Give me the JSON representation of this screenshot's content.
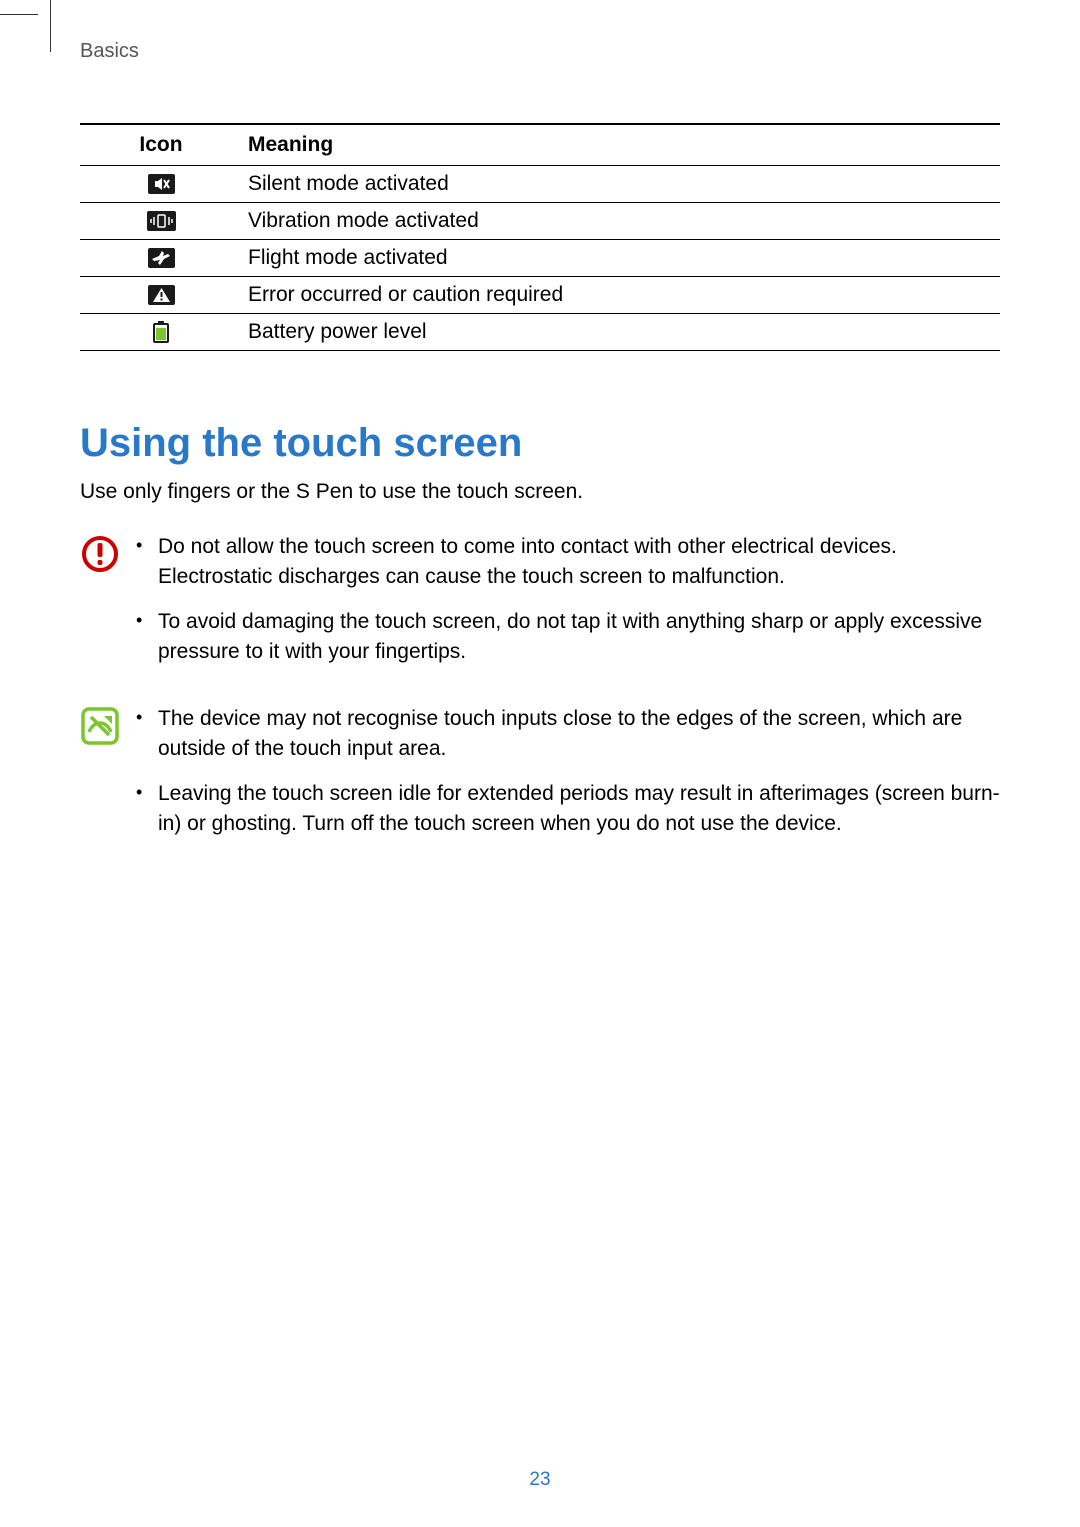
{
  "section_label": "Basics",
  "table": {
    "headers": {
      "icon": "Icon",
      "meaning": "Meaning"
    },
    "rows": [
      {
        "icon_name": "silent-mode-icon",
        "meaning": "Silent mode activated"
      },
      {
        "icon_name": "vibration-mode-icon",
        "meaning": "Vibration mode activated"
      },
      {
        "icon_name": "flight-mode-icon",
        "meaning": "Flight mode activated"
      },
      {
        "icon_name": "caution-icon",
        "meaning": "Error occurred or caution required"
      },
      {
        "icon_name": "battery-level-icon",
        "meaning": "Battery power level"
      }
    ]
  },
  "heading": "Using the touch screen",
  "intro": "Use only fingers or the S Pen to use the touch screen.",
  "callouts": [
    {
      "icon_name": "warning-circle-icon",
      "items": [
        "Do not allow the touch screen to come into contact with other electrical devices. Electrostatic discharges can cause the touch screen to malfunction.",
        "To avoid damaging the touch screen, do not tap it with anything sharp or apply excessive pressure to it with your fingertips."
      ]
    },
    {
      "icon_name": "note-square-icon",
      "items": [
        "The device may not recognise touch inputs close to the edges of the screen, which are outside of the touch input area.",
        "Leaving the touch screen idle for extended periods may result in afterimages (screen burn-in) or ghosting. Turn off the touch screen when you do not use the device."
      ]
    }
  ],
  "page_number": "23",
  "colors": {
    "heading": "#2a78c8",
    "warning": "#cc0000",
    "note_green": "#7bc62d",
    "icon_dark": "#1a1a1a"
  }
}
